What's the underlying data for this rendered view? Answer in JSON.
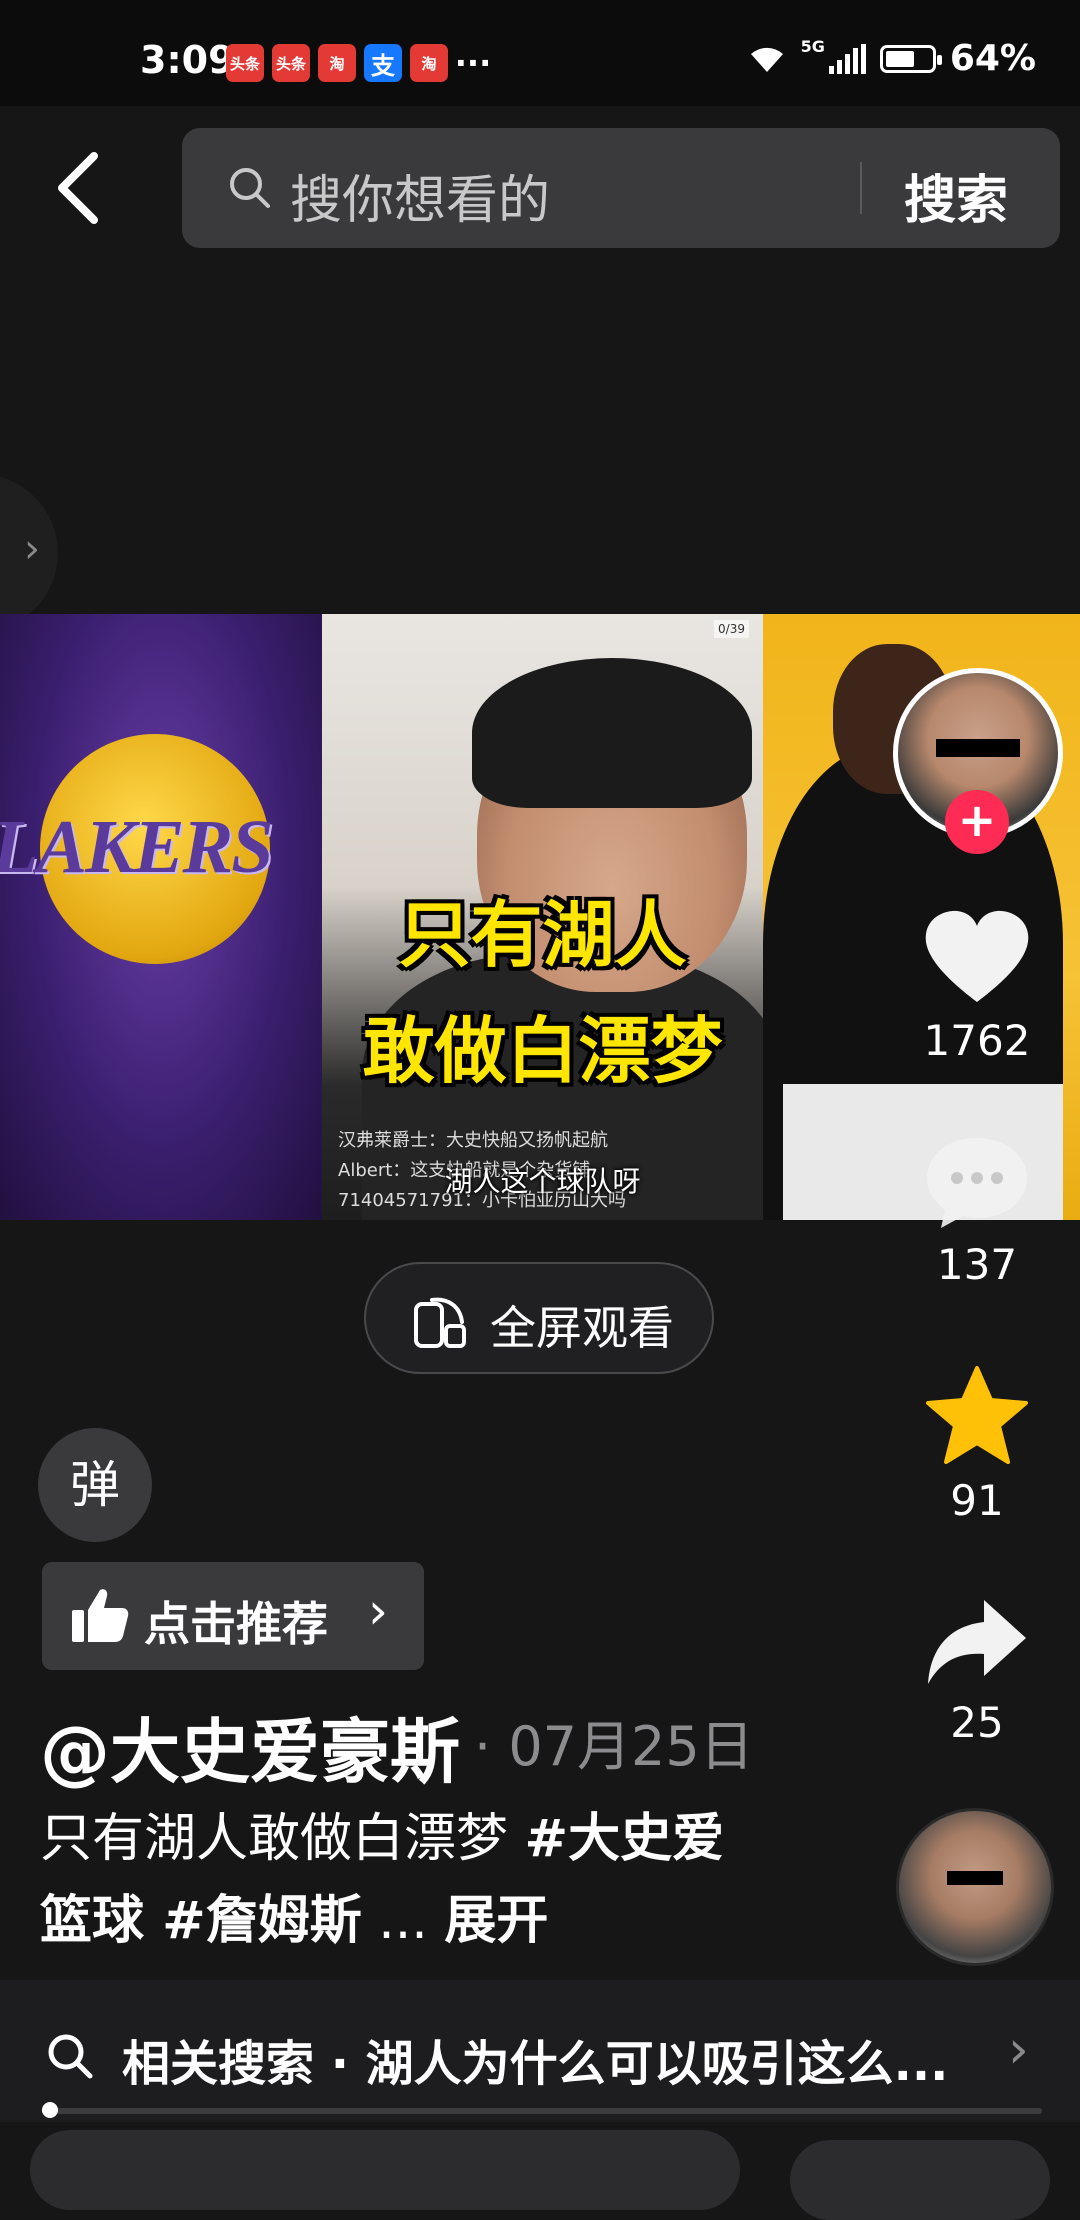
{
  "status_bar": {
    "time": "3:09",
    "notifications": [
      {
        "icon": "toutiao-icon",
        "label": "头条",
        "color": "#e43a36"
      },
      {
        "icon": "toutiao-icon",
        "label": "头条",
        "color": "#e43a36"
      },
      {
        "icon": "taobao-icon",
        "label": "淘",
        "color": "#e43a36"
      },
      {
        "icon": "alipay-icon",
        "label": "支",
        "color": "#1677ff"
      },
      {
        "icon": "taobao-icon",
        "label": "淘",
        "color": "#e43a36"
      }
    ],
    "more": "···",
    "network": "5G",
    "battery": "64%",
    "battery_level": 0.64
  },
  "search": {
    "placeholder": "搜你想看的",
    "button_label": "搜索"
  },
  "video": {
    "overlay_line1": "只有湖人",
    "overlay_line2": "敢做白漂梦",
    "subtitle": "湖人这个球队呀",
    "lakers_text": "LAKERS",
    "chat": [
      "汉弗莱爵士：大史快船又扬帆起航",
      "Albert：这支快船就是个杂货铺",
      "71404571791：小卡怕亚历山大吗"
    ],
    "badge": "0/39"
  },
  "actions": {
    "likes": "1762",
    "comments": "137",
    "favorites": "91",
    "shares": "25",
    "follow_symbol": "+"
  },
  "fullscreen_label": "全屏观看",
  "danmu_label": "弹",
  "recommend": {
    "label": "点击推荐",
    "chevron": "›"
  },
  "author": {
    "name": "@大史爱豪斯",
    "date": "· 07月25日"
  },
  "description": {
    "text": "只有湖人敢做白漂梦 ",
    "tag1": "#大史爱篮球",
    "tag2": " #詹姆斯",
    "ellipsis": " ... ",
    "expand": "展开"
  },
  "related": {
    "text": "相关搜索 · 湖人为什么可以吸引这么...",
    "chevron": "›"
  },
  "progress_fraction": 0.01,
  "colors": {
    "accent_red": "#fe2c55",
    "star": "#ffc107",
    "background": "#161617"
  }
}
